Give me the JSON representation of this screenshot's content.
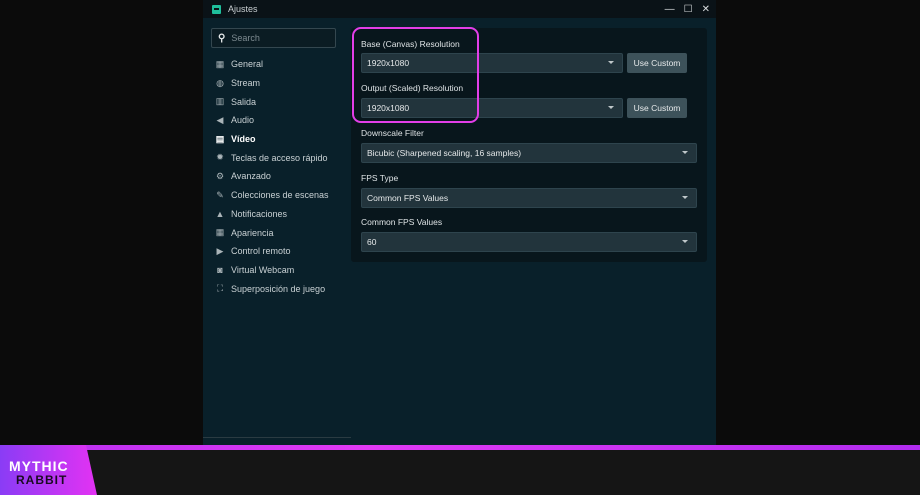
{
  "window": {
    "title": "Ajustes",
    "minimize": "—",
    "maximize": "☐",
    "close": "✕"
  },
  "sidebar": {
    "search_placeholder": "Search",
    "items": [
      {
        "label": "General",
        "icon": "▦"
      },
      {
        "label": "Stream",
        "icon": "◍"
      },
      {
        "label": "Salida",
        "icon": "▥"
      },
      {
        "label": "Audio",
        "icon": "◀"
      },
      {
        "label": "Vídeo",
        "icon": "▤",
        "active": true
      },
      {
        "label": "Teclas de acceso rápido",
        "icon": "✹"
      },
      {
        "label": "Avanzado",
        "icon": "⚙"
      },
      {
        "label": "Colecciones de escenas",
        "icon": "✎"
      },
      {
        "label": "Notificaciones",
        "icon": "▲"
      },
      {
        "label": "Apariencia",
        "icon": "▦"
      },
      {
        "label": "Control remoto",
        "icon": "▶"
      },
      {
        "label": "Virtual Webcam",
        "icon": "◙"
      },
      {
        "label": "Superposición de juego",
        "icon": "⛶"
      }
    ]
  },
  "settings": {
    "base_label": "Base (Canvas) Resolution",
    "base_value": "1920x1080",
    "output_label": "Output (Scaled) Resolution",
    "output_value": "1920x1080",
    "use_custom": "Use Custom",
    "filter_label": "Downscale Filter",
    "filter_value": "Bicubic (Sharpened scaling, 16 samples)",
    "fps_type_label": "FPS Type",
    "fps_type_value": "Common FPS Values",
    "fps_label": "Common FPS Values",
    "fps_value": "60"
  },
  "banner": {
    "line1": "MYTHIC",
    "line2": "RABBIT"
  },
  "colors": {
    "highlight": "#e23ee8",
    "accent": "#1fbf9c"
  }
}
